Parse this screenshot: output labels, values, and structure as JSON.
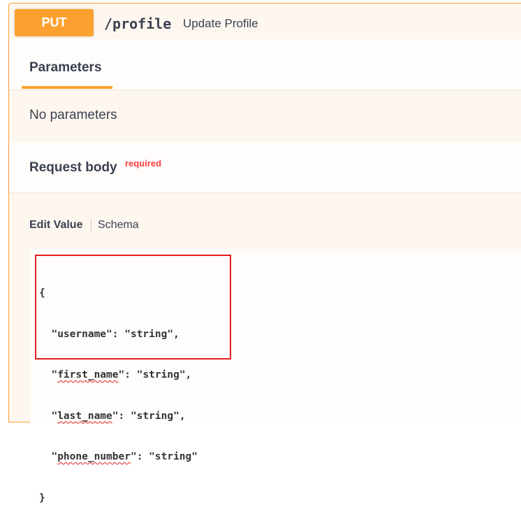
{
  "operation": {
    "method": "PUT",
    "path": "/profile",
    "summary": "Update Profile"
  },
  "parameters": {
    "tab_label": "Parameters",
    "empty_text": "No parameters"
  },
  "request_body": {
    "title": "Request body",
    "required_label": "required",
    "tabs": {
      "edit_value": "Edit Value",
      "schema": "Schema"
    },
    "code": {
      "open": "{",
      "lines": [
        {
          "indent": "  ",
          "q1": "\"",
          "key": "username",
          "q2": "\"",
          "rest": ": \"string\","
        },
        {
          "indent": "  ",
          "q1": "\"",
          "key": "first_name",
          "q2": "\"",
          "rest": ": \"string\","
        },
        {
          "indent": "  ",
          "q1": "\"",
          "key": "last_name",
          "q2": "\"",
          "rest": ": \"string\","
        },
        {
          "indent": "  ",
          "q1": "\"",
          "key": "phone_number",
          "q2": "\"",
          "rest": ": \"string\""
        }
      ],
      "close": "}"
    }
  },
  "colors": {
    "put_accent": "#fca130",
    "required_red": "#f93e3e",
    "highlight_red": "#e02020"
  }
}
